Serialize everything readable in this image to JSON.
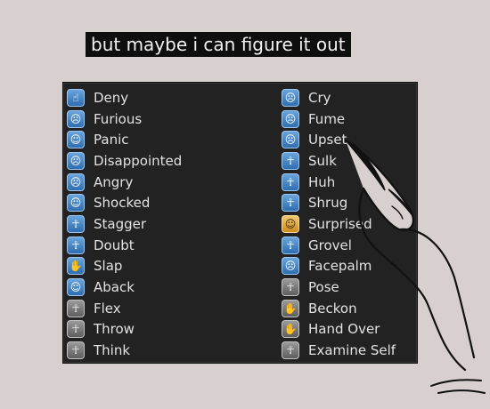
{
  "caption": "but maybe i can figure it out",
  "emotes_left": [
    {
      "label": "Deny",
      "icon": "deny-icon",
      "glyph": "☝",
      "tone": "blue"
    },
    {
      "label": "Furious",
      "icon": "furious-icon",
      "glyph": "☹",
      "tone": "blue"
    },
    {
      "label": "Panic",
      "icon": "panic-icon",
      "glyph": "☺",
      "tone": "blue"
    },
    {
      "label": "Disappointed",
      "icon": "disappointed-icon",
      "glyph": "☹",
      "tone": "blue"
    },
    {
      "label": "Angry",
      "icon": "angry-icon",
      "glyph": "☹",
      "tone": "blue"
    },
    {
      "label": "Shocked",
      "icon": "shocked-icon",
      "glyph": "☺",
      "tone": "blue"
    },
    {
      "label": "Stagger",
      "icon": "stagger-icon",
      "glyph": "☥",
      "tone": "blue"
    },
    {
      "label": "Doubt",
      "icon": "doubt-icon",
      "glyph": "☥",
      "tone": "blue"
    },
    {
      "label": "Slap",
      "icon": "slap-icon",
      "glyph": "✋",
      "tone": "blue"
    },
    {
      "label": "Aback",
      "icon": "aback-icon",
      "glyph": "☺",
      "tone": "blue"
    },
    {
      "label": "Flex",
      "icon": "flex-icon",
      "glyph": "☥",
      "tone": "grey"
    },
    {
      "label": "Throw",
      "icon": "throw-icon",
      "glyph": "☥",
      "tone": "grey"
    },
    {
      "label": "Think",
      "icon": "think-icon",
      "glyph": "☥",
      "tone": "grey"
    }
  ],
  "emotes_right": [
    {
      "label": "Cry",
      "icon": "cry-icon",
      "glyph": "☹",
      "tone": "blue"
    },
    {
      "label": "Fume",
      "icon": "fume-icon",
      "glyph": "☹",
      "tone": "blue"
    },
    {
      "label": "Upset",
      "icon": "upset-icon",
      "glyph": "☹",
      "tone": "blue"
    },
    {
      "label": "Sulk",
      "icon": "sulk-icon",
      "glyph": "☥",
      "tone": "blue"
    },
    {
      "label": "Huh",
      "icon": "huh-icon",
      "glyph": "☥",
      "tone": "blue"
    },
    {
      "label": "Shrug",
      "icon": "shrug-icon",
      "glyph": "☥",
      "tone": "blue"
    },
    {
      "label": "Surprised",
      "icon": "surprised-icon",
      "glyph": "☺",
      "tone": "orange"
    },
    {
      "label": "Grovel",
      "icon": "grovel-icon",
      "glyph": "☥",
      "tone": "blue"
    },
    {
      "label": "Facepalm",
      "icon": "facepalm-icon",
      "glyph": "☹",
      "tone": "blue"
    },
    {
      "label": "Pose",
      "icon": "pose-icon",
      "glyph": "☥",
      "tone": "grey"
    },
    {
      "label": "Beckon",
      "icon": "beckon-icon",
      "glyph": "✋",
      "tone": "grey"
    },
    {
      "label": "Hand Over",
      "icon": "hand-over-icon",
      "glyph": "✋",
      "tone": "grey"
    },
    {
      "label": "Examine Self",
      "icon": "examine-self-icon",
      "glyph": "☥",
      "tone": "grey"
    }
  ],
  "colors": {
    "page_background": "#d7d0cf",
    "panel_background": "#222222",
    "label_text": "#e2e2e2",
    "icon_blue": "#4a8ccb",
    "icon_orange": "#e0a840",
    "icon_grey": "#7a7a7a"
  }
}
